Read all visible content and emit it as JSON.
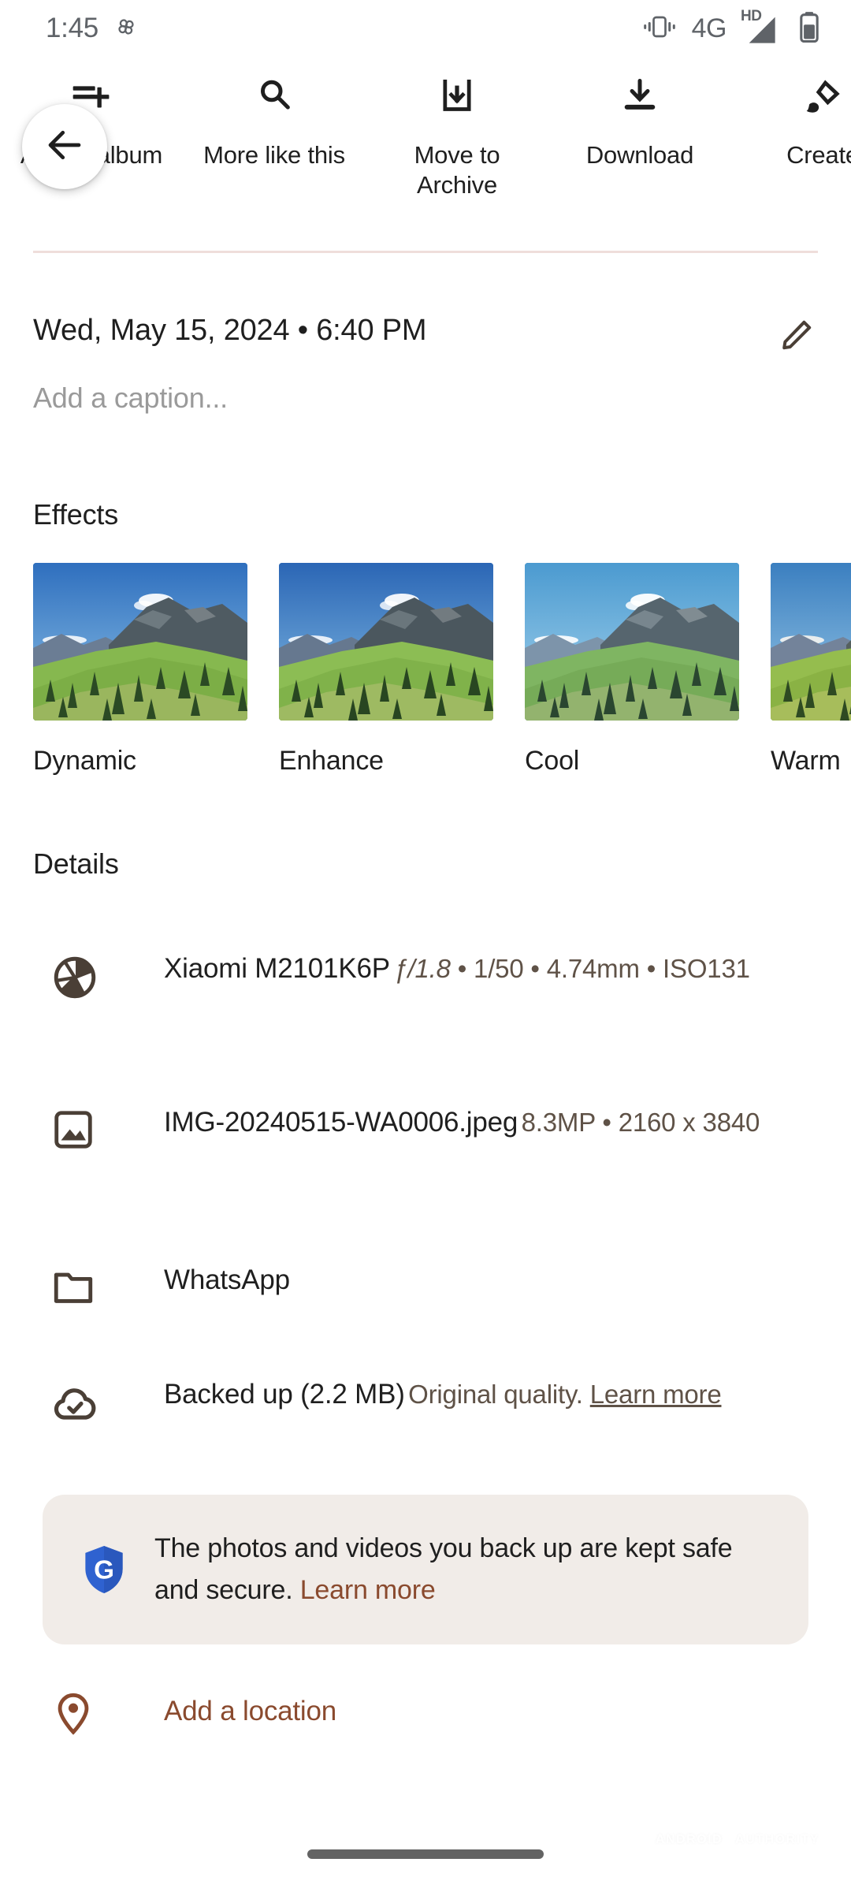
{
  "status_bar": {
    "clock": "1:45",
    "app_icon": "pinwheel-icon",
    "vibrate_icon": "vibrate-icon",
    "network": "4G",
    "hd": "HD",
    "signal_icon": "signal-bars-icon",
    "battery_icon": "battery-icon"
  },
  "action_bar": {
    "back_icon": "arrow-back-icon",
    "items": [
      {
        "label": "Add to album",
        "icon": "playlist-add-icon"
      },
      {
        "label": "More like this",
        "icon": "search-icon"
      },
      {
        "label": "Move to Archive",
        "icon": "archive-icon"
      },
      {
        "label": "Download",
        "icon": "download-icon"
      },
      {
        "label": "Create",
        "icon": "palette-brush-icon"
      }
    ]
  },
  "header": {
    "date": "Wed, May 15, 2024  •  6:40 PM",
    "edit_icon": "pencil-edit-icon",
    "caption_placeholder": "Add a caption..."
  },
  "effects": {
    "title": "Effects",
    "items": [
      {
        "label": "Dynamic",
        "sky_top": "#2f6fbe",
        "sky_bottom": "#8fc4e8",
        "grass": "#86b84f",
        "saturation": 1.15
      },
      {
        "label": "Enhance",
        "sky_top": "#2b66b5",
        "sky_bottom": "#86bfe6",
        "grass": "#8cbd54",
        "saturation": 1.08
      },
      {
        "label": "Cool",
        "sky_top": "#4b9ad0",
        "sky_bottom": "#a9d6ee",
        "grass": "#7fb562",
        "saturation": 0.95
      },
      {
        "label": "Warm",
        "sky_top": "#3b7fc0",
        "sky_bottom": "#9ccbe8",
        "grass": "#95bd4e",
        "saturation": 1.1
      }
    ]
  },
  "details": {
    "title": "Details",
    "rows": [
      {
        "icon": "camera-aperture-icon",
        "primary": "Xiaomi M2101K6P",
        "secondary_aperture": "ƒ/1.8",
        "secondary": " • 1/50 • 4.74mm • ISO131"
      },
      {
        "icon": "image-icon",
        "primary": "IMG-20240515-WA0006.jpeg",
        "secondary": "8.3MP • 2160 x 3840"
      },
      {
        "icon": "folder-icon",
        "primary": "WhatsApp",
        "secondary": ""
      },
      {
        "icon": "cloud-done-icon",
        "primary": "Backed up (2.2 MB)",
        "secondary": "Original quality. ",
        "secondary_link": "Learn more"
      }
    ]
  },
  "banner": {
    "icon": "google-shield-icon",
    "text": "The photos and videos you back up are kept safe and secure. ",
    "link": "Learn more",
    "background": "#f1ece8"
  },
  "location": {
    "icon": "location-pin-icon",
    "label": "Add a location",
    "color": "#8a4a2e"
  },
  "watermark": {
    "part1": "ANDROID",
    "part2": "AUTHORITY"
  },
  "nav": {
    "gesture_pill": "home-gesture-pill"
  }
}
